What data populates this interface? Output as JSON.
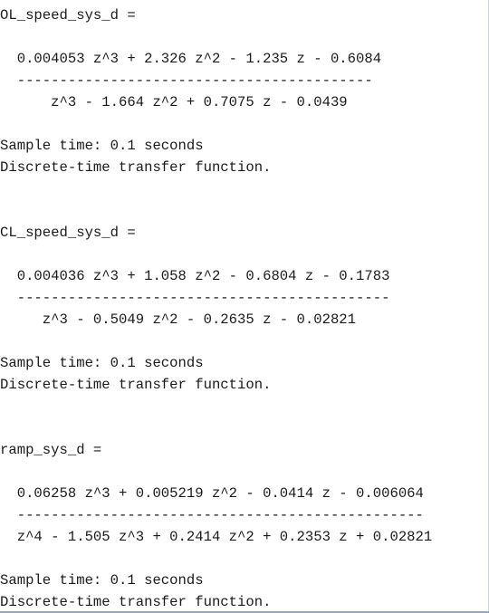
{
  "blocks": [
    {
      "header": "OL_speed_sys_d =",
      "numerator": "  0.004053 z^3 + 2.326 z^2 - 1.235 z - 0.6084",
      "fraction_bar": "  ------------------------------------------",
      "denominator": "      z^3 - 1.664 z^2 + 0.7075 z - 0.0439",
      "sample_time": "Sample time: 0.1 seconds",
      "description": "Discrete-time transfer function."
    },
    {
      "header": "CL_speed_sys_d =",
      "numerator": "  0.004036 z^3 + 1.058 z^2 - 0.6804 z - 0.1783",
      "fraction_bar": "  --------------------------------------------",
      "denominator": "     z^3 - 0.5049 z^2 - 0.2635 z - 0.02821",
      "sample_time": "Sample time: 0.1 seconds",
      "description": "Discrete-time transfer function."
    },
    {
      "header": "ramp_sys_d =",
      "numerator": "  0.06258 z^3 + 0.005219 z^2 - 0.0414 z - 0.006064",
      "fraction_bar": "  ------------------------------------------------",
      "denominator": "  z^4 - 1.505 z^3 + 0.2414 z^2 + 0.2353 z + 0.02821",
      "sample_time": "Sample time: 0.1 seconds",
      "description": "Discrete-time transfer function."
    }
  ]
}
